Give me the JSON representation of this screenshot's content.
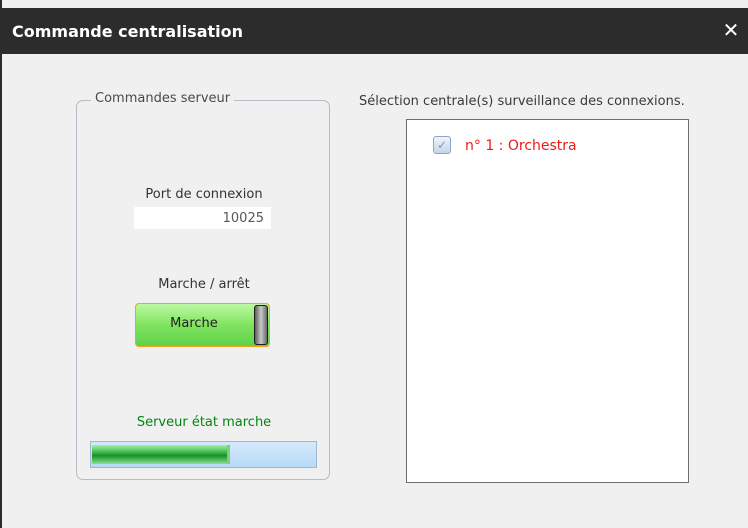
{
  "window": {
    "title": "Commande centralisation",
    "close_icon": "close-icon"
  },
  "server_commands": {
    "group_title": "Commandes serveur",
    "port_label": "Port de connexion",
    "port_value": "10025",
    "state_label": "Marche / arrêt",
    "toggle_label": "Marche",
    "status_text": "Serveur état marche",
    "progress_fraction": 0.62
  },
  "monitoring": {
    "caption": "Sélection centrale(s) surveillance des connexions.",
    "items": [
      {
        "label": "n° 1 : Orchestra",
        "checked": true,
        "checkbox_icon": "check-icon"
      }
    ]
  },
  "colors": {
    "titlebar": "#2c2c2c",
    "toggle_border": "#f3a51b",
    "running_text": "#058312",
    "item_text": "#ed1a1a"
  }
}
